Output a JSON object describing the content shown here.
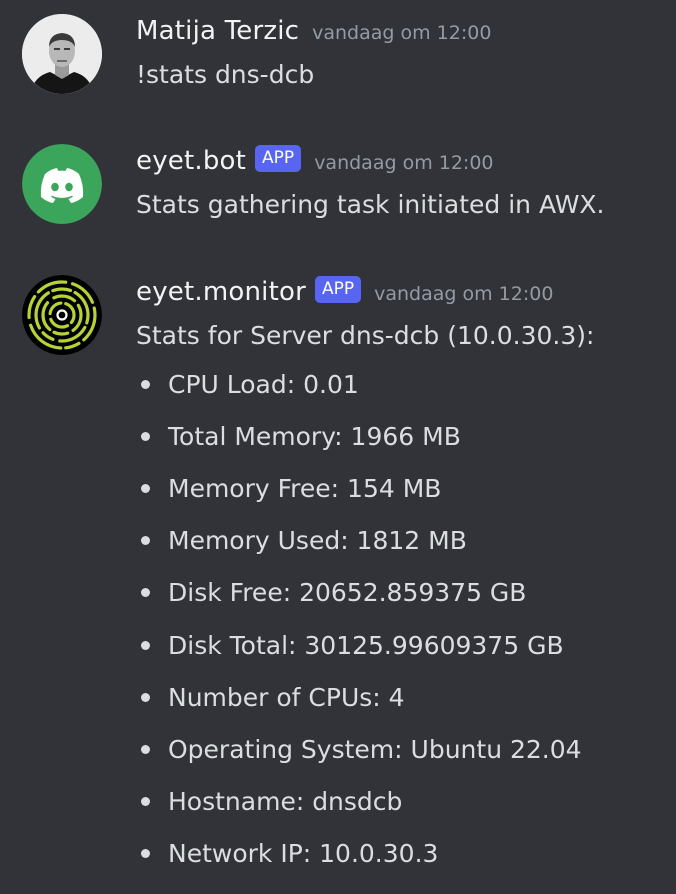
{
  "messages": [
    {
      "author": "Matija Terzic",
      "timestamp": "vandaag om 12:00",
      "content": "!stats dns-dcb",
      "avatar_icon": "user-photo"
    },
    {
      "author": "eyet.bot",
      "badge": "APP",
      "timestamp": "vandaag om 12:00",
      "content": "Stats gathering task initiated in AWX.",
      "avatar_icon": "discord-logo-icon",
      "avatar_color": "#3ba55c"
    },
    {
      "author": "eyet.monitor",
      "badge": "APP",
      "timestamp": "vandaag om 12:00",
      "content": "Stats for Server dns-dcb (10.0.30.3):",
      "avatar_icon": "concentric-rings-logo",
      "avatar_color": "#000000",
      "accent": "#b5d334",
      "bullets": [
        "CPU Load: 0.01",
        "Total Memory: 1966 MB",
        "Memory Free: 154 MB",
        "Memory Used: 1812 MB",
        "Disk Free: 20652.859375 GB",
        "Disk Total: 30125.99609375 GB",
        "Number of CPUs: 4",
        "Operating System: Ubuntu 22.04",
        "Hostname: dnsdcb",
        "Network IP: 10.0.30.3"
      ]
    }
  ],
  "colors": {
    "background": "#313338",
    "username": "#f2f3f5",
    "text": "#dbdee1",
    "timestamp": "#949ba4",
    "badge": "#5865f2"
  }
}
